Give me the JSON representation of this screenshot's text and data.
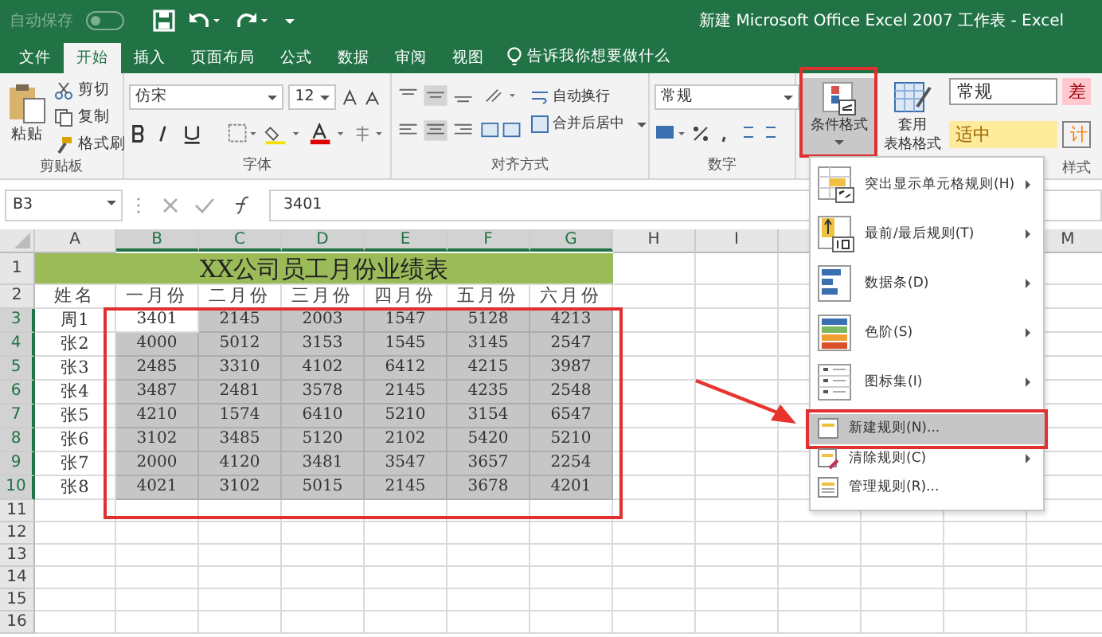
{
  "title_bar": {
    "autosave": "自动保存",
    "autosave_on": false,
    "title": "新建 Microsoft Office Excel 2007 工作表  -  Excel"
  },
  "tabs": [
    {
      "label": "文件",
      "selected": false
    },
    {
      "label": "开始",
      "selected": true
    },
    {
      "label": "插入",
      "selected": false
    },
    {
      "label": "页面布局",
      "selected": false
    },
    {
      "label": "公式",
      "selected": false
    },
    {
      "label": "数据",
      "selected": false
    },
    {
      "label": "审阅",
      "selected": false
    },
    {
      "label": "视图",
      "selected": false
    }
  ],
  "tell_me": "告诉我你想要做什么",
  "ribbon": {
    "clipboard": {
      "paste": "粘贴",
      "cut": "剪切",
      "copy": "复制",
      "format_painter": "格式刷",
      "label": "剪贴板"
    },
    "font": {
      "font_name": "仿宋",
      "font_size": "12",
      "label": "字体"
    },
    "alignment": {
      "wrap": "自动换行",
      "merge": "合并后居中",
      "label": "对齐方式"
    },
    "number": {
      "format": "常规",
      "label": "数字"
    },
    "styles": {
      "conditional_format": {
        "label": "条件格式",
        "pressed": true,
        "outlined": true
      },
      "table_format": {
        "line1": "套用",
        "line2": "表格格式"
      },
      "gallery": [
        {
          "label": "常规",
          "kind": "normal"
        },
        {
          "label": "差",
          "kind": "bad"
        },
        {
          "label": "适中",
          "kind": "neutral"
        },
        {
          "label": "计",
          "kind": "calc"
        }
      ],
      "label": "样式"
    }
  },
  "formula_bar": {
    "name_box": "B3",
    "value": "3401"
  },
  "sheet": {
    "columns": [
      {
        "label": "A",
        "selected": false
      },
      {
        "label": "B",
        "selected": true
      },
      {
        "label": "C",
        "selected": true
      },
      {
        "label": "D",
        "selected": true
      },
      {
        "label": "E",
        "selected": true
      },
      {
        "label": "F",
        "selected": true
      },
      {
        "label": "G",
        "selected": true
      },
      {
        "label": "H",
        "selected": false
      },
      {
        "label": "I",
        "selected": false
      }
    ],
    "last_column": "M",
    "title_row": {
      "header": "1",
      "title": "XX公司员工月份业绩表"
    },
    "header_row": {
      "header": "2",
      "cells": [
        "姓名",
        "一月份",
        "二月份",
        "三月份",
        "四月份",
        "五月份",
        "六月份"
      ]
    },
    "rows": [
      {
        "header": "3",
        "name": "周1",
        "values": [
          "3401",
          "2145",
          "2003",
          "1547",
          "5128",
          "4213"
        ],
        "selected": true,
        "active_cell": true
      },
      {
        "header": "4",
        "name": "张2",
        "values": [
          "4000",
          "5012",
          "3153",
          "1545",
          "3145",
          "2547"
        ],
        "selected": true,
        "active_cell": false
      },
      {
        "header": "5",
        "name": "张3",
        "values": [
          "2485",
          "3310",
          "4102",
          "6412",
          "4215",
          "3987"
        ],
        "selected": true,
        "active_cell": false
      },
      {
        "header": "6",
        "name": "张4",
        "values": [
          "3487",
          "2481",
          "3578",
          "2145",
          "4235",
          "2548"
        ],
        "selected": true,
        "active_cell": false
      },
      {
        "header": "7",
        "name": "张5",
        "values": [
          "4210",
          "1574",
          "6410",
          "5210",
          "3154",
          "6547"
        ],
        "selected": true,
        "active_cell": false
      },
      {
        "header": "8",
        "name": "张6",
        "values": [
          "3102",
          "3485",
          "5120",
          "2102",
          "5420",
          "5210"
        ],
        "selected": true,
        "active_cell": false
      },
      {
        "header": "9",
        "name": "张7",
        "values": [
          "2000",
          "4120",
          "3481",
          "3547",
          "3657",
          "2254"
        ],
        "selected": true,
        "active_cell": false
      },
      {
        "header": "10",
        "name": "张8",
        "values": [
          "4021",
          "3102",
          "5015",
          "2145",
          "3678",
          "4201"
        ],
        "selected": true,
        "active_cell": false
      }
    ],
    "empty_rows": [
      "11",
      "12",
      "13",
      "14",
      "15",
      "16"
    ],
    "range_outlined": true
  },
  "menu": {
    "items": [
      {
        "label": "突出显示单元格规则(H)",
        "kind": "highlight",
        "submenu": true,
        "highlighted": false,
        "outlined": false
      },
      {
        "label": "最前/最后规则(T)",
        "kind": "topbottom",
        "submenu": true,
        "highlighted": false,
        "outlined": false
      },
      {
        "label": "数据条(D)",
        "kind": "databar",
        "submenu": true,
        "highlighted": false,
        "outlined": false
      },
      {
        "label": "色阶(S)",
        "kind": "colorscale",
        "submenu": true,
        "highlighted": false,
        "outlined": false
      },
      {
        "label": "图标集(I)",
        "kind": "iconset",
        "submenu": true,
        "highlighted": false,
        "outlined": false
      },
      {
        "label": "新建规则(N)...",
        "kind": "new",
        "submenu": false,
        "highlighted": true,
        "outlined": true
      },
      {
        "label": "清除规则(C)",
        "kind": "clear",
        "submenu": true,
        "highlighted": false,
        "outlined": false
      },
      {
        "label": "管理规则(R)...",
        "kind": "manage",
        "submenu": false,
        "highlighted": false,
        "outlined": false
      }
    ]
  },
  "pointer_arrow": true
}
